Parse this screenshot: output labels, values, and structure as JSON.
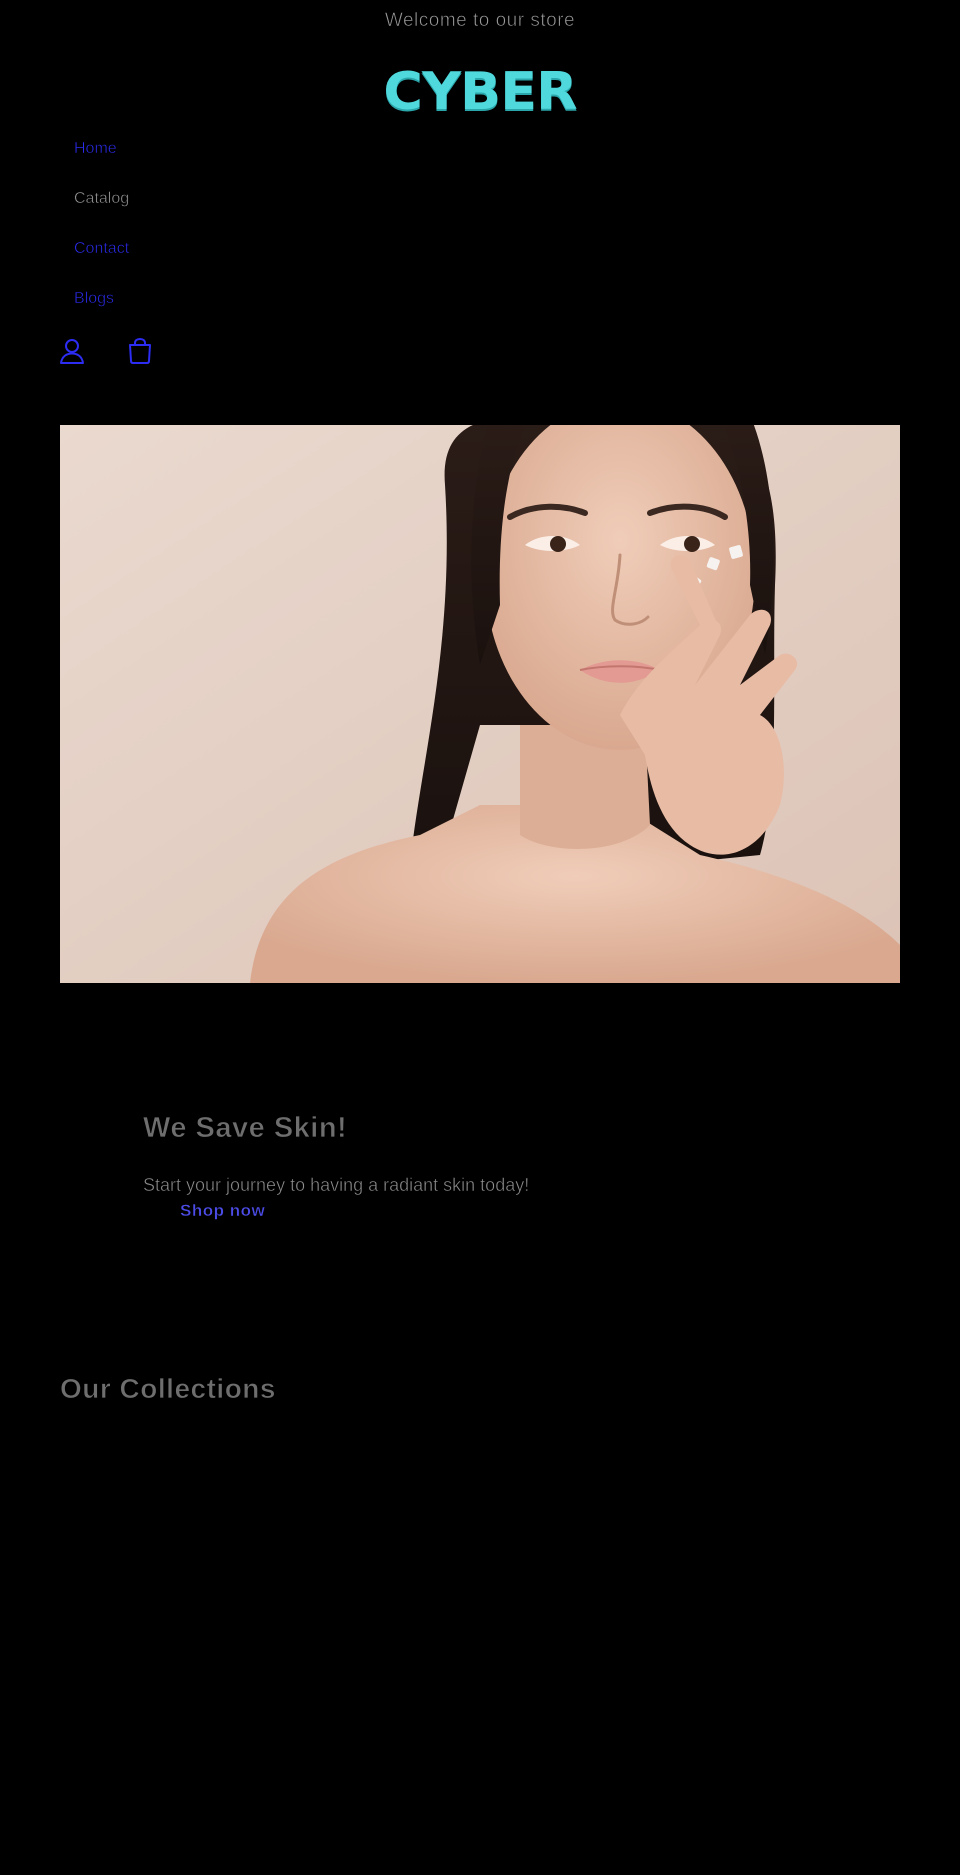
{
  "announcement": {
    "text": "Welcome to our store"
  },
  "header": {
    "logo_text": "CYBER",
    "nav": [
      {
        "label": "Home",
        "state": "link"
      },
      {
        "label": "Catalog",
        "state": "current"
      },
      {
        "label": "Contact",
        "state": "link"
      },
      {
        "label": "Blogs",
        "state": "link"
      }
    ],
    "icons": {
      "account": "account-icon",
      "cart": "cart-icon"
    }
  },
  "hero": {
    "image": "woman-applying-face-cream"
  },
  "banner": {
    "heading": "We Save Skin!",
    "text": "Start your journey to having a radiant skin today!",
    "button_label": "Shop now"
  },
  "collections": {
    "heading": "Our Collections"
  },
  "colors": {
    "background": "#000000",
    "logo": "#4fd9dd",
    "link": "#2c2cf2",
    "button": "#4c4ce8",
    "muted_text": "#8e8e8e",
    "hero_bg": "#e8d6cc"
  }
}
